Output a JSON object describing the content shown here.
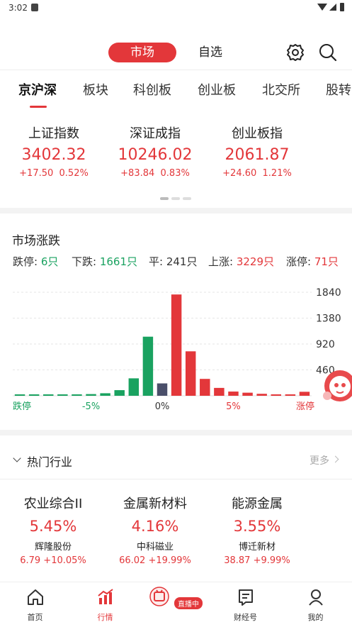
{
  "status_bar": {
    "time": "3:02"
  },
  "topbar": {
    "market_tab": "市场",
    "watchlist_tab": "自选"
  },
  "tabs": [
    "京沪深",
    "板块",
    "科创板",
    "创业板",
    "北交所",
    "股转"
  ],
  "indices": [
    {
      "name": "上证指数",
      "price": "3402.32",
      "change": "+17.50",
      "pct": "0.52%"
    },
    {
      "name": "深证成指",
      "price": "10246.02",
      "change": "+83.84",
      "pct": "0.83%"
    },
    {
      "name": "创业板指",
      "price": "2061.87",
      "change": "+24.60",
      "pct": "1.21%"
    }
  ],
  "market": {
    "title": "市场涨跌",
    "stats": {
      "limit_down_label": "跌停:",
      "limit_down_value": "6只",
      "down_label": "下跌:",
      "down_value": "1661只",
      "flat_label": "平:",
      "flat_value": "241只",
      "up_label": "上涨:",
      "up_value": "3229只",
      "limit_up_label": "涨停:",
      "limit_up_value": "71只"
    }
  },
  "chart_data": {
    "type": "bar",
    "yticks": [
      "1840",
      "1380",
      "920",
      "460"
    ],
    "ylim": [
      0,
      1840
    ],
    "xtick_labels": [
      "跌停",
      "-5%",
      "0%",
      "5%",
      "涨停"
    ],
    "values": [
      6,
      10,
      12,
      20,
      25,
      30,
      45,
      100,
      310,
      1050,
      220,
      1800,
      790,
      300,
      140,
      75,
      55,
      35,
      25,
      15,
      71
    ],
    "colors": [
      "#1aa260",
      "#1aa260",
      "#1aa260",
      "#1aa260",
      "#1aa260",
      "#1aa260",
      "#1aa260",
      "#1aa260",
      "#1aa260",
      "#1aa260",
      "#4a4f6a",
      "#e3373a",
      "#e3373a",
      "#e3373a",
      "#e3373a",
      "#e3373a",
      "#e3373a",
      "#e3373a",
      "#e3373a",
      "#e3373a",
      "#e3373a"
    ]
  },
  "hot": {
    "title": "热门行业",
    "more": "更多"
  },
  "industries": [
    {
      "name": "农业综合II",
      "pct": "5.45%",
      "stock": "辉隆股份",
      "price": "6.79 +10.05%"
    },
    {
      "name": "金属新材料",
      "pct": "4.16%",
      "stock": "中科磁业",
      "price": "66.02 +19.99%"
    },
    {
      "name": "能源金属",
      "pct": "3.55%",
      "stock": "博迁新材",
      "price": "38.87 +9.99%"
    }
  ],
  "nav": {
    "home": "首页",
    "market": "行情",
    "live": "直播中",
    "caijing": "财经号",
    "mine": "我的"
  }
}
